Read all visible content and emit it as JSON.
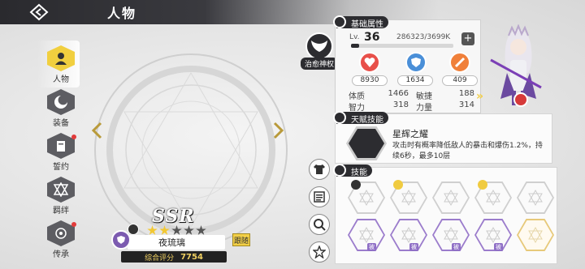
{
  "page": {
    "title": "人物"
  },
  "nav": {
    "items": [
      {
        "label": "人物",
        "icon": "person-icon",
        "active": true,
        "badge": false
      },
      {
        "label": "装备",
        "icon": "equipment-icon",
        "active": false,
        "badge": false
      },
      {
        "label": "誓约",
        "icon": "oath-icon",
        "active": false,
        "badge": true
      },
      {
        "label": "羁绊",
        "icon": "bond-icon",
        "active": false,
        "badge": false
      },
      {
        "label": "传承",
        "icon": "inherit-icon",
        "active": false,
        "badge": true
      }
    ]
  },
  "character": {
    "rarity": "SSR",
    "stars_filled": 2,
    "stars_total": 5,
    "name": "夜琉璃",
    "score_label": "综合评分",
    "score": "7754",
    "follow_label": "跟随",
    "class_label": "治愈神权"
  },
  "basic": {
    "title": "基础属性",
    "lv_prefix": "Lv.",
    "level": "36",
    "exp": "286323/3699K",
    "exp_progress": 0.077,
    "stats": [
      {
        "name": "hp",
        "icon": "heart-icon",
        "color": "#e8504a",
        "value": "8930"
      },
      {
        "name": "def",
        "icon": "shield-icon",
        "color": "#4a8fd8",
        "value": "1634"
      },
      {
        "name": "atk",
        "icon": "sword-icon",
        "color": "#f0803a",
        "value": "409"
      }
    ],
    "attrs": [
      {
        "name": "体质",
        "value": "1466"
      },
      {
        "name": "敏捷",
        "value": "188"
      },
      {
        "name": "智力",
        "value": "318"
      },
      {
        "name": "力量",
        "value": "314"
      }
    ]
  },
  "talent": {
    "title": "天赋技能",
    "name": "星辉之耀",
    "description": "攻击时有概率降低敌人的暴击和爆伤1.2%，持续6秒，最多10层"
  },
  "skills": {
    "title": "技能",
    "lock_label": "被",
    "row1": [
      {
        "type": "normal",
        "badge": "dark"
      },
      {
        "type": "normal",
        "badge": "gold"
      },
      {
        "type": "normal",
        "badge": ""
      },
      {
        "type": "normal",
        "badge": "gold"
      },
      {
        "type": "normal",
        "badge": ""
      }
    ],
    "row2": [
      {
        "type": "purple"
      },
      {
        "type": "purple"
      },
      {
        "type": "purple"
      },
      {
        "type": "purple"
      },
      {
        "type": "gold"
      }
    ]
  }
}
